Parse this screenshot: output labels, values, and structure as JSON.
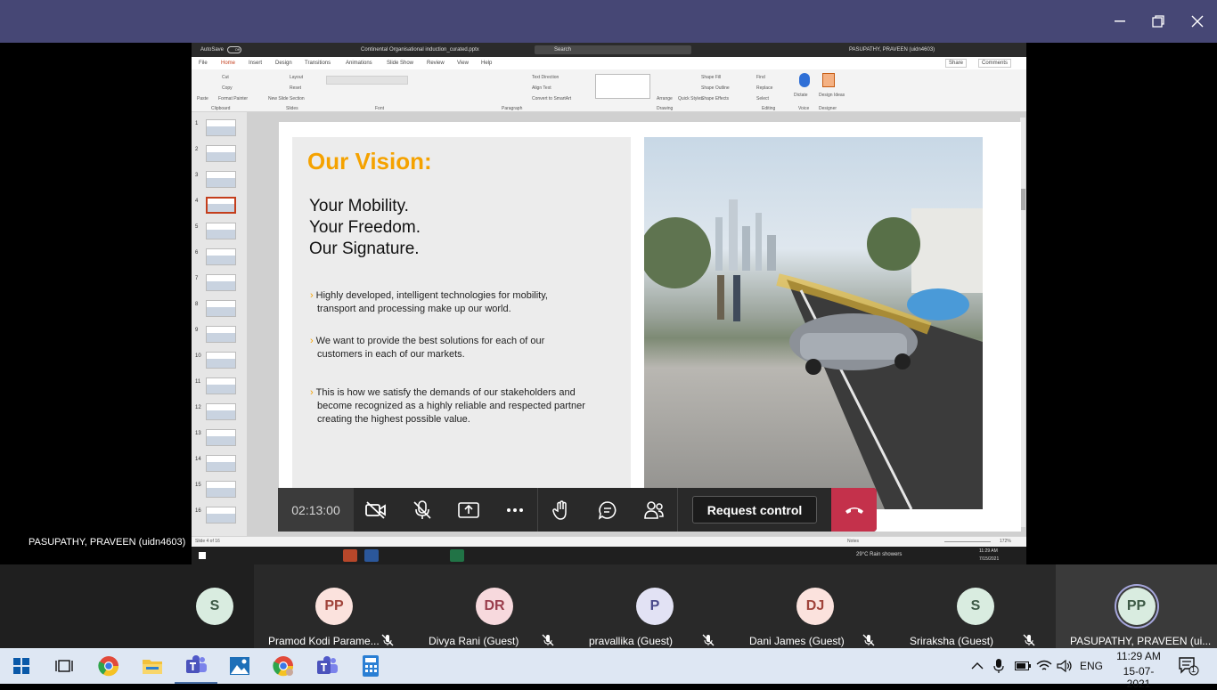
{
  "window": {
    "minimize_icon": "minimize-icon",
    "maximize_icon": "restore-icon",
    "close_icon": "close-icon"
  },
  "ppt": {
    "filename": "Continental Organisational induction_curated.pptx",
    "autosave": "AutoSave",
    "autosave_state": "Off",
    "search_placeholder": "Search",
    "user": "PASUPATHY, PRAVEEN (uidn4603)",
    "menu": [
      "File",
      "Home",
      "Insert",
      "Design",
      "Transitions",
      "Animations",
      "Slide Show",
      "Review",
      "View",
      "Help"
    ],
    "share_label": "Share",
    "comments_label": "Comments",
    "ribbon_groups": [
      "Clipboard",
      "Slides",
      "Font",
      "Paragraph",
      "Drawing",
      "Editing",
      "Voice",
      "Designer"
    ],
    "ribbon_items": {
      "paste": "Paste",
      "cut": "Cut",
      "copy": "Copy",
      "format_painter": "Format Painter",
      "new_slide": "New Slide",
      "layout": "Layout",
      "reset": "Reset",
      "section": "Section",
      "text_direction": "Text Direction",
      "align_text": "Align Text",
      "convert_smartart": "Convert to SmartArt",
      "arrange": "Arrange",
      "quick_styles": "Quick Styles",
      "shape_fill": "Shape Fill",
      "shape_outline": "Shape Outline",
      "shape_effects": "Shape Effects",
      "find": "Find",
      "replace": "Replace",
      "select": "Select",
      "dictate": "Dictate",
      "design_ideas": "Design Ideas"
    },
    "thumbs": [
      "1",
      "2",
      "3",
      "4",
      "5",
      "6",
      "7",
      "8",
      "9",
      "10",
      "11",
      "12",
      "13",
      "14",
      "15",
      "16"
    ],
    "status_slide": "Slide 4 of 16",
    "notes": "Notes",
    "zoom": "172%"
  },
  "slide": {
    "heading": "Our Vision:",
    "motto": [
      "Your Mobility.",
      "Your Freedom.",
      "Our Signature."
    ],
    "bullets": [
      [
        "Highly developed, intelligent technologies for mobility,",
        "transport and processing make up our world."
      ],
      [
        "We want to provide the best solutions for each of our",
        "customers in each of our markets."
      ],
      [
        "This is how we satisfy the demands of our stakeholders and",
        "become recognized as a highly reliable and respected partner",
        "creating the highest possible value."
      ]
    ],
    "bullet_mark": "›"
  },
  "inner_taskbar": {
    "weather": "29°C  Rain showers",
    "time": "11:29 AM",
    "date": "7/15/2021"
  },
  "presenter_label": "PASUPATHY, PRAVEEN (uidn4603)",
  "call": {
    "timer": "02:13:00",
    "request_control": "Request control",
    "icons": [
      "camera-off-icon",
      "mic-off-icon",
      "share-screen-icon",
      "more-icon",
      "raise-hand-icon",
      "chat-icon",
      "participants-icon",
      "hang-up-icon"
    ]
  },
  "participants": [
    {
      "initials": "S",
      "name": "",
      "bg": "#d9ece0",
      "fg": "#3d5a46"
    },
    {
      "initials": "PP",
      "name": "Pramod Kodi Parame...",
      "bg": "#fbe2dd",
      "fg": "#a0433a"
    },
    {
      "initials": "DR",
      "name": "Divya Rani (Guest)",
      "bg": "#f7d9dd",
      "fg": "#9a3d4c"
    },
    {
      "initials": "P",
      "name": "pravallika (Guest)",
      "bg": "#e2e2f4",
      "fg": "#4a4a8a"
    },
    {
      "initials": "DJ",
      "name": "Dani James (Guest)",
      "bg": "#fbe2dd",
      "fg": "#a0433a"
    },
    {
      "initials": "S",
      "name": "Sriraksha (Guest)",
      "bg": "#d9ece0",
      "fg": "#3d5a46"
    },
    {
      "initials": "PP",
      "name": "PASUPATHY, PRAVEEN (ui...",
      "bg": "#d9ece0",
      "fg": "#3d5a46"
    }
  ],
  "taskbar": {
    "apps": [
      "windows-start-icon",
      "task-view-icon",
      "chrome-icon",
      "file-explorer-icon",
      "teams-icon",
      "photos-icon",
      "chrome-profile-icon",
      "teams-classic-icon",
      "calculator-icon"
    ],
    "lang": "ENG",
    "time": "11:29 AM",
    "date": "15-07-2021",
    "notifications": "1"
  }
}
